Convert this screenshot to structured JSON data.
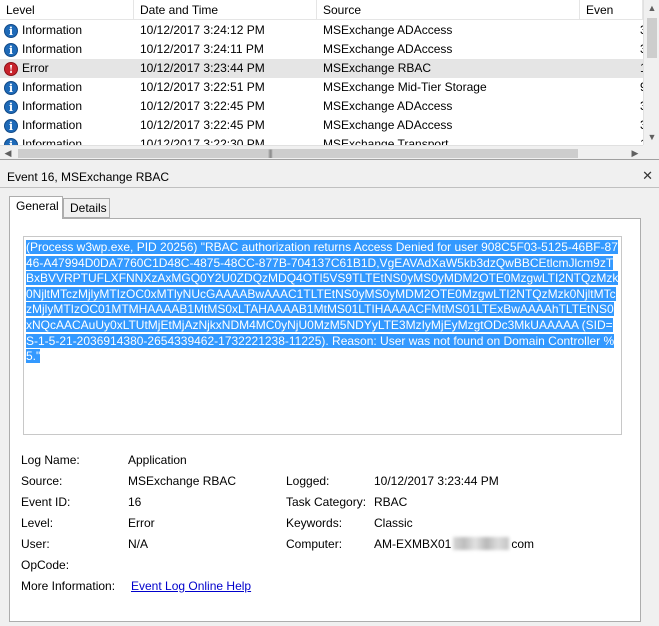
{
  "list": {
    "columns": [
      "Level",
      "Date and Time",
      "Source",
      "Even"
    ],
    "rows": [
      {
        "level": "Information",
        "icon": "info-icon",
        "datetime": "10/12/2017 3:24:12 PM",
        "source": "MSExchange ADAccess",
        "event": "3"
      },
      {
        "level": "Information",
        "icon": "info-icon",
        "datetime": "10/12/2017 3:24:11 PM",
        "source": "MSExchange ADAccess",
        "event": "3"
      },
      {
        "level": "Error",
        "icon": "error-icon",
        "datetime": "10/12/2017 3:23:44 PM",
        "source": "MSExchange RBAC",
        "event": "1",
        "selected": true
      },
      {
        "level": "Information",
        "icon": "info-icon",
        "datetime": "10/12/2017 3:22:51 PM",
        "source": "MSExchange Mid-Tier Storage",
        "event": "9"
      },
      {
        "level": "Information",
        "icon": "info-icon",
        "datetime": "10/12/2017 3:22:45 PM",
        "source": "MSExchange ADAccess",
        "event": "3"
      },
      {
        "level": "Information",
        "icon": "info-icon",
        "datetime": "10/12/2017 3:22:45 PM",
        "source": "MSExchange ADAccess",
        "event": "3"
      },
      {
        "level": "Information",
        "icon": "info-icon",
        "datetime": "10/12/2017 3:22:30 PM",
        "source": "MSExchange Transport",
        "event": "1"
      }
    ]
  },
  "detail": {
    "title": "Event 16, MSExchange RBAC",
    "tabs": [
      "General",
      "Details"
    ],
    "message": "(Process w3wp.exe, PID 20256) \"RBAC authorization returns Access Denied for user 908C5F03-5125-46BF-8746-A47994D0DA7760C1D48C-4875-48CC-877B-704137C61B1D,VgEAVAdXaW5kb3dzQwBBCEtlcmJlcm9zTBxBVVRPTUFLXFNNXzAxMGQ0Y2U0ZDQzMDQ4OTI5VS9TLTEtNS0yMS0yMDM2OTE0MzgwLTI2NTQzMzk0NjltMTczMjlyMTIzOC0xMTlyNUcGAAAABwAAAC1TLTEtNS0yMS0yMDM2OTE0MzgwLTI2NTQzMzk0NjltMTczMjlyMTIzOC01MTMHAAAAB1MtMS0xLTAHAAAAB1MtMS01LTIHAAAACFMtMS01LTExBwAAAAhTLTEtNS0xNQcAACAuUy0xLTUtMjEtMjAzNjkxNDM4MC0yNjU0MzM5NDYyLTE3MzIyMjEyMzgtODc3MkUAAAAA (SID=S-1-5-21-2036914380-2654339462-1732221238-11225). Reason: User was not found on Domain Controller %5.\"",
    "fields": {
      "log_name_label": "Log Name:",
      "log_name": "Application",
      "source_label": "Source:",
      "source": "MSExchange RBAC",
      "logged_label": "Logged:",
      "logged": "10/12/2017 3:23:44 PM",
      "event_id_label": "Event ID:",
      "event_id": "16",
      "task_category_label": "Task Category:",
      "task_category": "RBAC",
      "level_label": "Level:",
      "level": "Error",
      "keywords_label": "Keywords:",
      "keywords": "Classic",
      "user_label": "User:",
      "user": "N/A",
      "computer_label": "Computer:",
      "computer_prefix": "AM-EXMBX01",
      "computer_suffix": "com",
      "opcode_label": "OpCode:",
      "opcode": "",
      "more_info_label": "More Information:",
      "more_info_link": "Event Log Online Help"
    }
  }
}
